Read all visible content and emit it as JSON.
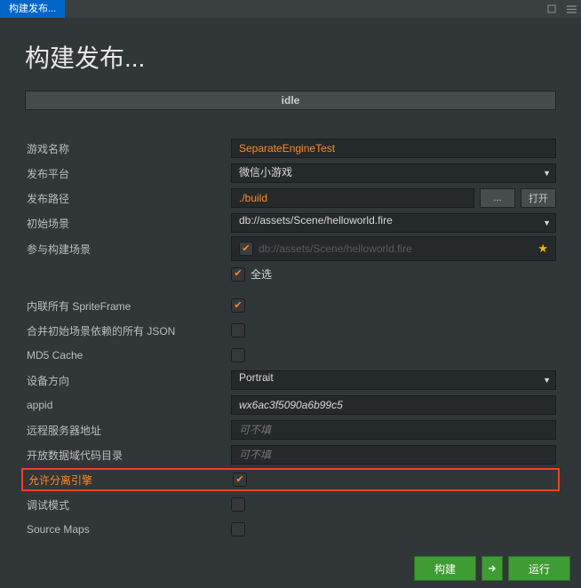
{
  "tab_title": "构建发布...",
  "page_title": "构建发布...",
  "status": "idle",
  "labels": {
    "game_name": "游戏名称",
    "platform": "发布平台",
    "build_path": "发布路径",
    "start_scene": "初始场景",
    "scenes": "参与构建场景",
    "select_all": "全选",
    "inline_sprite": "内联所有 SpriteFrame",
    "merge_json": "合并初始场景依赖的所有 JSON",
    "md5": "MD5 Cache",
    "orientation": "设备方向",
    "appid": "appid",
    "remote": "远程服务器地址",
    "open_data": "开放数据域代码目录",
    "sep_engine": "允许分离引擎",
    "debug": "调试模式",
    "source_maps": "Source Maps"
  },
  "values": {
    "game_name": "SeparateEngineTest",
    "platform": "微信小游戏",
    "build_path": "./build",
    "start_scene": "db://assets/Scene/helloworld.fire",
    "scene_item": "db://assets/Scene/helloworld.fire",
    "orientation": "Portrait",
    "appid": "wx6ac3f5090a6b99c5",
    "remote_placeholder": "可不填",
    "open_data_placeholder": "可不填"
  },
  "buttons": {
    "browse": "...",
    "open": "打开",
    "build": "构建",
    "run": "运行"
  },
  "checks": {
    "select_all": true,
    "inline_sprite": true,
    "merge_json": false,
    "md5": false,
    "sep_engine": true,
    "debug": false,
    "source_maps": false
  }
}
